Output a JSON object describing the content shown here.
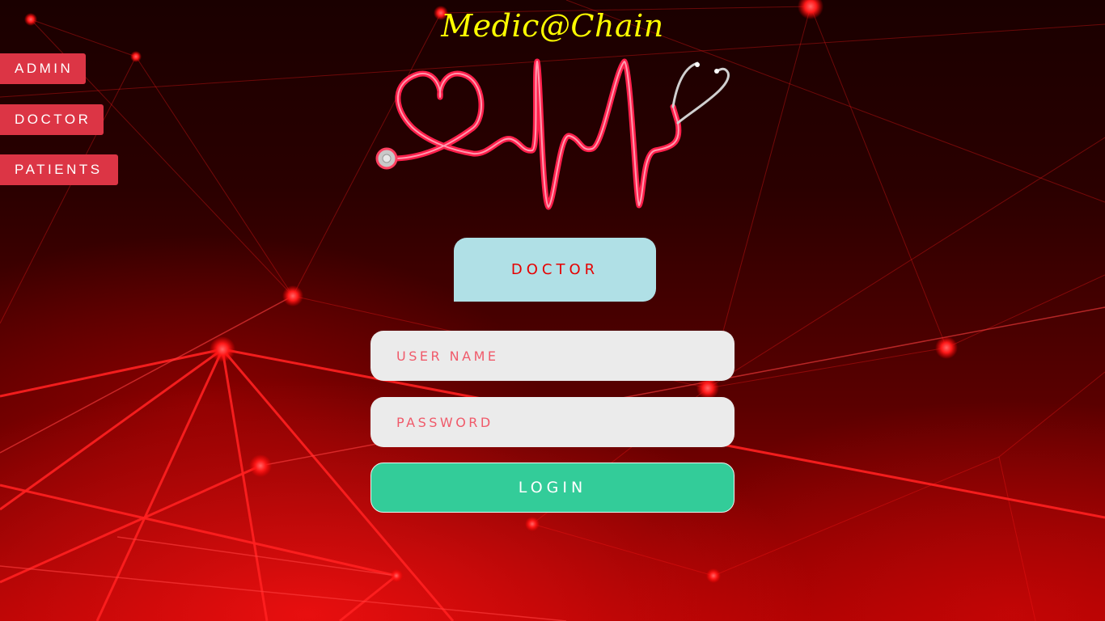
{
  "brand": {
    "title": "Medic@Chain",
    "logo_icon": "heartbeat-stethoscope-icon"
  },
  "role_nav": {
    "items": [
      {
        "label": "ADMIN"
      },
      {
        "label": "DOCTOR"
      },
      {
        "label": "PATIENTS"
      }
    ]
  },
  "login_form": {
    "title": "DOCTOR",
    "username": {
      "value": "",
      "placeholder": "USER NAME"
    },
    "password": {
      "value": "",
      "placeholder": "PASSWORD"
    },
    "submit_label": "LOGIN"
  },
  "colors": {
    "title": "#ffff00",
    "role_button": "#dc3545",
    "form_title_bg": "#b0e0e6",
    "form_title_text": "#e60000",
    "input_bg": "#ebebeb",
    "placeholder": "#f05a6a",
    "login_button": "#33cc99",
    "background": "#8b0000"
  }
}
